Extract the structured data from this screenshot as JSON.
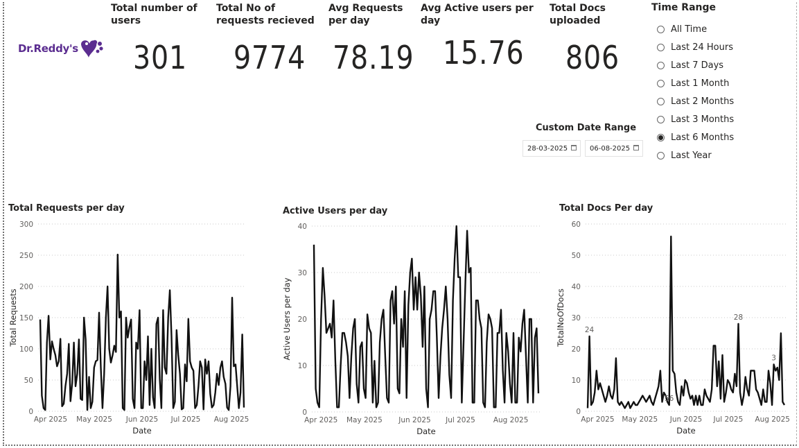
{
  "brand": {
    "logo_text": "Dr.Reddy's",
    "color": "#5b2d90"
  },
  "kpis": [
    {
      "title": "Total number of users",
      "value": "301"
    },
    {
      "title": "Total No of requests recieved",
      "value": "9774"
    },
    {
      "title": "Avg Requests per day",
      "value": "78.19"
    },
    {
      "title": "Avg Active users per day",
      "value": "15.76"
    },
    {
      "title": "Total Docs uploaded",
      "value": "806"
    }
  ],
  "time_range": {
    "title": "Time Range",
    "options": [
      "All Time",
      "Last 24 Hours",
      "Last 7 Days",
      "Last 1 Month",
      "Last 2 Months",
      "Last 3 Months",
      "Last 6 Months",
      "Last Year"
    ],
    "selected": "Last 6 Months"
  },
  "custom_date_range": {
    "title": "Custom Date Range",
    "start": "28-03-2025",
    "end": "06-08-2025"
  },
  "chart_data": [
    {
      "type": "line",
      "title": "Total Requests per day",
      "xlabel": "Date",
      "ylabel": "Total Requests",
      "ylim": [
        0,
        300
      ],
      "yticks": [
        0,
        50,
        100,
        150,
        200,
        250,
        300
      ],
      "xticks": [
        "Apr 2025",
        "May 2025",
        "Jun 2025",
        "Jul 2025",
        "Aug 2025"
      ],
      "grid": true,
      "series": [
        {
          "values": [
            147,
            25,
            5,
            2,
            110,
            153,
            83,
            112,
            100,
            90,
            72,
            80,
            116,
            8,
            12,
            40,
            60,
            108,
            16,
            45,
            110,
            40,
            60,
            115,
            20,
            18,
            150,
            115,
            2,
            55,
            5,
            15,
            70,
            80,
            82,
            158,
            70,
            5,
            60,
            150,
            200,
            100,
            78,
            90,
            105,
            95,
            251,
            150,
            160,
            5,
            2,
            150,
            118,
            135,
            147,
            20,
            5,
            110,
            100,
            162,
            5,
            5,
            80,
            50,
            120,
            10,
            100,
            22,
            5,
            140,
            150,
            52,
            5,
            162,
            70,
            60,
            150,
            194,
            120,
            5,
            15,
            130,
            90,
            60,
            3,
            5,
            75,
            48,
            148,
            80,
            70,
            65,
            5,
            10,
            40,
            80,
            70,
            3,
            83,
            60,
            80,
            28,
            6,
            10,
            30,
            60,
            42,
            70,
            80,
            55,
            44,
            6,
            2,
            40,
            182,
            72,
            75,
            40,
            5,
            30,
            123,
            6
          ]
        }
      ]
    },
    {
      "type": "line",
      "title": "Active Users per day",
      "xlabel": "Date",
      "ylabel": "Active Users per day",
      "ylim": [
        0,
        40
      ],
      "yticks": [
        0,
        10,
        20,
        30,
        40
      ],
      "xticks": [
        "Apr 2025",
        "May 2025",
        "Jun 2025",
        "Jul 2025",
        "Aug 2025"
      ],
      "grid": true,
      "series": [
        {
          "values": [
            36,
            5,
            2,
            1,
            20,
            31,
            25,
            17,
            18,
            19,
            16,
            24,
            11,
            1,
            1,
            10,
            17,
            17,
            15,
            12,
            3,
            12,
            18,
            20,
            6,
            2,
            14,
            15,
            5,
            3,
            21,
            18,
            17,
            2,
            11,
            1,
            2,
            15,
            20,
            22,
            12,
            3,
            2,
            24,
            26,
            19,
            27,
            5,
            4,
            20,
            14,
            26,
            3,
            23,
            30,
            33,
            22,
            29,
            22,
            30,
            25,
            14,
            27,
            5,
            1,
            20,
            22,
            26,
            26,
            16,
            3,
            12,
            18,
            22,
            27,
            20,
            8,
            3,
            24,
            33,
            40,
            29,
            29,
            2,
            15,
            28,
            39,
            30,
            31,
            2,
            2,
            24,
            24,
            20,
            18,
            2,
            1,
            15,
            21,
            20,
            18,
            1,
            1,
            17,
            17,
            22,
            9,
            2,
            17,
            13,
            6,
            2,
            17,
            2,
            2,
            16,
            13,
            19,
            22,
            12,
            2,
            20,
            20,
            2,
            16,
            18,
            4
          ]
        }
      ]
    },
    {
      "type": "line",
      "title": "Total Docs Per day",
      "xlabel": "Date",
      "ylabel": "TotalNoOfDocs",
      "ylim": [
        0,
        60
      ],
      "yticks": [
        0,
        10,
        20,
        30,
        40,
        50,
        60
      ],
      "xticks": [
        "Apr 2025",
        "May 2025",
        "Jun 2025",
        "Jul 2025",
        "Aug 2025"
      ],
      "grid": true,
      "data_labels": [
        {
          "x_index": 1,
          "text": "24"
        },
        {
          "x_index": 46,
          "text": "56"
        },
        {
          "x_index": 85,
          "text": "28"
        },
        {
          "x_index": 105,
          "text": "3"
        }
      ],
      "series": [
        {
          "values": [
            1,
            24,
            2,
            3,
            6,
            13,
            7,
            9,
            7,
            5,
            3,
            5,
            8,
            5,
            4,
            7,
            17,
            3,
            2,
            3,
            2,
            1,
            2,
            3,
            1,
            2,
            3,
            2,
            2,
            3,
            4,
            5,
            4,
            3,
            4,
            5,
            3,
            2,
            4,
            6,
            8,
            13,
            3,
            6,
            5,
            3,
            2,
            56,
            13,
            12,
            6,
            3,
            2,
            8,
            5,
            10,
            9,
            6,
            4,
            5,
            2,
            5,
            2,
            5,
            2,
            2,
            7,
            5,
            4,
            3,
            7,
            21,
            21,
            8,
            16,
            4,
            18,
            3,
            6,
            10,
            9,
            7,
            6,
            12,
            8,
            28,
            6,
            2,
            5,
            11,
            7,
            5,
            13,
            13,
            13,
            7,
            6,
            4,
            2,
            7,
            3,
            3,
            13,
            9,
            2,
            15,
            13,
            14,
            10,
            25,
            3,
            2
          ]
        }
      ]
    }
  ]
}
